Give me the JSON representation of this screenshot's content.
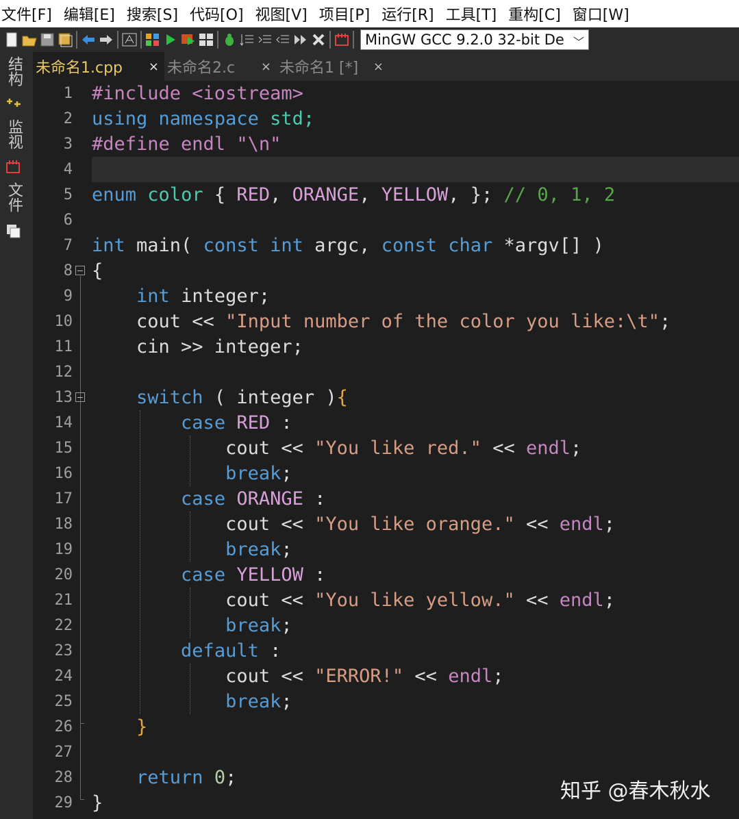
{
  "menu": [
    "文件[F]",
    "编辑[E]",
    "搜索[S]",
    "代码[O]",
    "视图[V]",
    "项目[P]",
    "运行[R]",
    "工具[T]",
    "重构[C]",
    "窗口[W]"
  ],
  "toolbar": {
    "compiler": "MinGW GCC 9.2.0 32-bit De"
  },
  "side_tabs": [
    "结构",
    "监视",
    "文件"
  ],
  "tabs": [
    {
      "label": "未命名1.cpp",
      "close": "×",
      "active": true
    },
    {
      "label": "未命名2.c",
      "close": "×",
      "active": false
    },
    {
      "label": "未命名1 [*]",
      "close": "×",
      "active": false
    }
  ],
  "line_numbers": [
    "1",
    "2",
    "3",
    "4",
    "5",
    "6",
    "7",
    "8",
    "9",
    "10",
    "11",
    "12",
    "13",
    "14",
    "15",
    "16",
    "17",
    "18",
    "19",
    "20",
    "21",
    "22",
    "23",
    "24",
    "25",
    "26",
    "27",
    "28",
    "29"
  ],
  "code": {
    "l1": {
      "a": "#include <iostream>"
    },
    "l2": {
      "a": "using",
      "b": " ",
      "c": "namespace",
      "d": " std;"
    },
    "l3": {
      "a": "#define endl \"\\n\""
    },
    "l5": {
      "a": "enum",
      "b": " ",
      "c": "color",
      "d": " { ",
      "e": "RED",
      "f": ", ",
      "g": "ORANGE",
      "h": ", ",
      "i": "YELLOW",
      "j": ", }; ",
      "k": "// 0, 1, 2"
    },
    "l7": {
      "a": "int",
      "b": " main( ",
      "c": "const",
      "d": " ",
      "e": "int",
      "f": " argc, ",
      "g": "const",
      "h": " ",
      "i": "char",
      "j": " *argv[] )"
    },
    "l8": {
      "a": "{"
    },
    "l9": {
      "a": "    ",
      "b": "int",
      "c": " integer;"
    },
    "l10": {
      "a": "    cout << ",
      "b": "\"Input number of the color you like:\\t\"",
      "c": ";"
    },
    "l11": {
      "a": "    cin >> integer;"
    },
    "l13": {
      "a": "    ",
      "b": "switch",
      "c": " ( integer )",
      "d": "{"
    },
    "l14": {
      "a": "        ",
      "b": "case",
      "c": " ",
      "d": "RED",
      "e": " :"
    },
    "l15": {
      "a": "            cout << ",
      "b": "\"You like red.\"",
      "c": " << ",
      "d": "endl",
      "e": ";"
    },
    "l16": {
      "a": "            ",
      "b": "break",
      "c": ";"
    },
    "l17": {
      "a": "        ",
      "b": "case",
      "c": " ",
      "d": "ORANGE",
      "e": " :"
    },
    "l18": {
      "a": "            cout << ",
      "b": "\"You like orange.\"",
      "c": " << ",
      "d": "endl",
      "e": ";"
    },
    "l19": {
      "a": "            ",
      "b": "break",
      "c": ";"
    },
    "l20": {
      "a": "        ",
      "b": "case",
      "c": " ",
      "d": "YELLOW",
      "e": " :"
    },
    "l21": {
      "a": "            cout << ",
      "b": "\"You like yellow.\"",
      "c": " << ",
      "d": "endl",
      "e": ";"
    },
    "l22": {
      "a": "            ",
      "b": "break",
      "c": ";"
    },
    "l23": {
      "a": "        ",
      "b": "default",
      "c": " :"
    },
    "l24": {
      "a": "            cout << ",
      "b": "\"ERROR!\"",
      "c": " << ",
      "d": "endl",
      "e": ";"
    },
    "l25": {
      "a": "            ",
      "b": "break",
      "c": ";"
    },
    "l26": {
      "a": "    ",
      "b": "}"
    },
    "l28": {
      "a": "    ",
      "b": "return",
      "c": " ",
      "d": "0",
      "e": ";"
    },
    "l29": {
      "a": "}"
    }
  },
  "watermark": "知乎 @春木秋水",
  "colors": {
    "background": "#1e1e1e",
    "keyword": "#569cd6",
    "type": "#4ec9b0",
    "enum_value": "#d7a0d7",
    "string": "#d69d85",
    "comment": "#57a64a",
    "active_tab": "#e8c96a"
  }
}
